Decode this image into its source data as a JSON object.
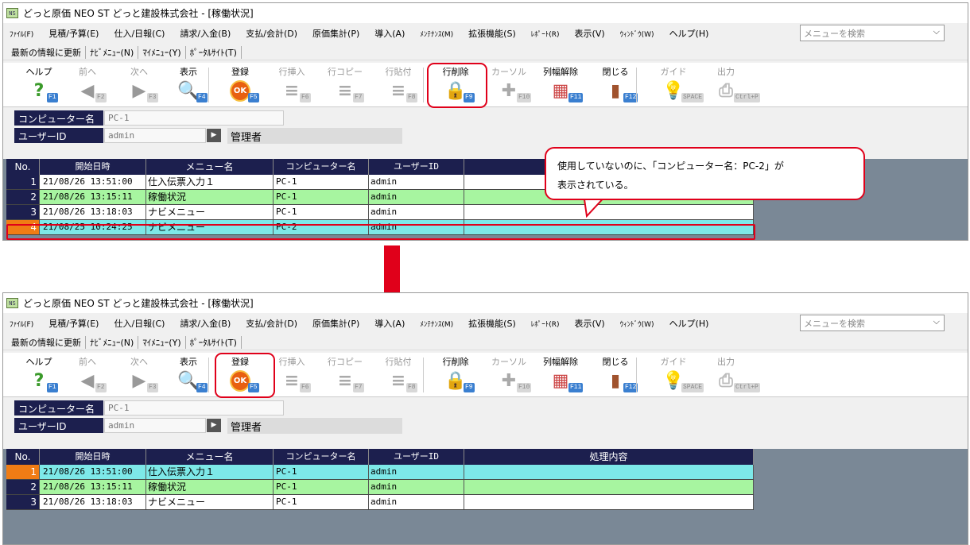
{
  "window_title": "どっと原価 NEO ST どっと建設株式会社 - [稼働状況]",
  "app_icon_text": "NS",
  "menu": [
    "ﾌｧｲﾙ(F)",
    "見積/予算(E)",
    "仕入/日報(C)",
    "請求/入金(B)",
    "支払/会計(D)",
    "原価集計(P)",
    "導入(A)",
    "ﾒﾝﾃﾅﾝｽ(M)",
    "拡張機能(S)",
    "ﾚﾎﾟｰﾄ(R)",
    "表示(V)",
    "ｳｨﾝﾄﾞｳ(W)",
    "ヘルプ(H)"
  ],
  "menu_search_placeholder": "メニューを検索",
  "links": [
    "最新の情報に更新",
    "ﾅﾋﾞﾒﾆｭｰ(N)",
    "ﾏｲﾒﾆｭｰ(Y)",
    "ﾎﾟｰﾀﾙｻｲﾄ(T)"
  ],
  "toolbar": [
    {
      "label": "ヘルプ",
      "key": "F1",
      "icon": "?",
      "color": "#3a9a2a",
      "enabled": true
    },
    {
      "label": "前へ",
      "key": "F2",
      "icon": "◀",
      "color": "#999",
      "enabled": false
    },
    {
      "label": "次へ",
      "key": "F3",
      "icon": "▶",
      "color": "#999",
      "enabled": false
    },
    {
      "label": "表示",
      "key": "F4",
      "icon": "🔍",
      "color": "#2a6ab0",
      "enabled": true
    },
    {
      "label": "登録",
      "key": "F5",
      "icon": "OK",
      "color": "#e05a00",
      "enabled": true
    },
    {
      "label": "行挿入",
      "key": "F6",
      "icon": "≡",
      "color": "#aaa",
      "enabled": false
    },
    {
      "label": "行コピー",
      "key": "F7",
      "icon": "≡",
      "color": "#aaa",
      "enabled": false
    },
    {
      "label": "行貼付",
      "key": "F8",
      "icon": "≡",
      "color": "#aaa",
      "enabled": false
    },
    {
      "label": "行削除",
      "key": "F9",
      "icon": "🔒",
      "color": "#c33",
      "enabled": true
    },
    {
      "label": "カーソル",
      "key": "F10",
      "icon": "✚",
      "color": "#aaa",
      "enabled": false
    },
    {
      "label": "列幅解除",
      "key": "F11",
      "icon": "▦",
      "color": "#c44",
      "enabled": true
    },
    {
      "label": "閉じる",
      "key": "F12",
      "icon": "▮",
      "color": "#a0522d",
      "enabled": true
    },
    {
      "label": "ガイド",
      "key": "SPACE",
      "icon": "💡",
      "color": "#ccc",
      "enabled": false
    },
    {
      "label": "出力",
      "key": "Ctrl+P",
      "icon": "⎙",
      "color": "#bbb",
      "enabled": false
    }
  ],
  "fields": {
    "computer_label": "コンピューター名",
    "computer_value": "PC-1",
    "user_label": "ユーザーID",
    "user_value": "admin",
    "user_name": "管理者"
  },
  "grid_headers": [
    "No.",
    "開始日時",
    "メニュー名",
    "コンピューター名",
    "ユーザーID",
    "処理内容"
  ],
  "before": {
    "headers_visible": [
      "No.",
      "開始日時",
      "メニュー名",
      "コンピューター名",
      "ユーザーID"
    ],
    "rows": [
      {
        "no": "1",
        "start": "21/08/26 13:51:00",
        "menu": "仕入伝票入力１",
        "computer": "PC-1",
        "user": "admin",
        "detail": "",
        "style": "white"
      },
      {
        "no": "2",
        "start": "21/08/26 13:15:11",
        "menu": "稼働状況",
        "computer": "PC-1",
        "user": "admin",
        "detail": "",
        "style": "green"
      },
      {
        "no": "3",
        "start": "21/08/26 13:18:03",
        "menu": "ナビメニュー",
        "computer": "PC-1",
        "user": "admin",
        "detail": "",
        "style": "white"
      },
      {
        "no": "4",
        "start": "21/08/25 10:24:25",
        "menu": "ナビメニュー",
        "computer": "PC-2",
        "user": "admin",
        "detail": "",
        "style": "cyan"
      }
    ]
  },
  "after": {
    "rows": [
      {
        "no": "1",
        "start": "21/08/26 13:51:00",
        "menu": "仕入伝票入力１",
        "computer": "PC-1",
        "user": "admin",
        "detail": "",
        "style": "cyan"
      },
      {
        "no": "2",
        "start": "21/08/26 13:15:11",
        "menu": "稼働状況",
        "computer": "PC-1",
        "user": "admin",
        "detail": "",
        "style": "green"
      },
      {
        "no": "3",
        "start": "21/08/26 13:18:03",
        "menu": "ナビメニュー",
        "computer": "PC-1",
        "user": "admin",
        "detail": "",
        "style": "white"
      }
    ]
  },
  "callout": {
    "line1": "使用していないのに、「コンピューター名：PC-2」が",
    "line2": "表示されている。"
  },
  "colors": {
    "highlight": "#e0001a",
    "header_bg": "#1c1f4e",
    "selected_marker": "#f07c14"
  }
}
